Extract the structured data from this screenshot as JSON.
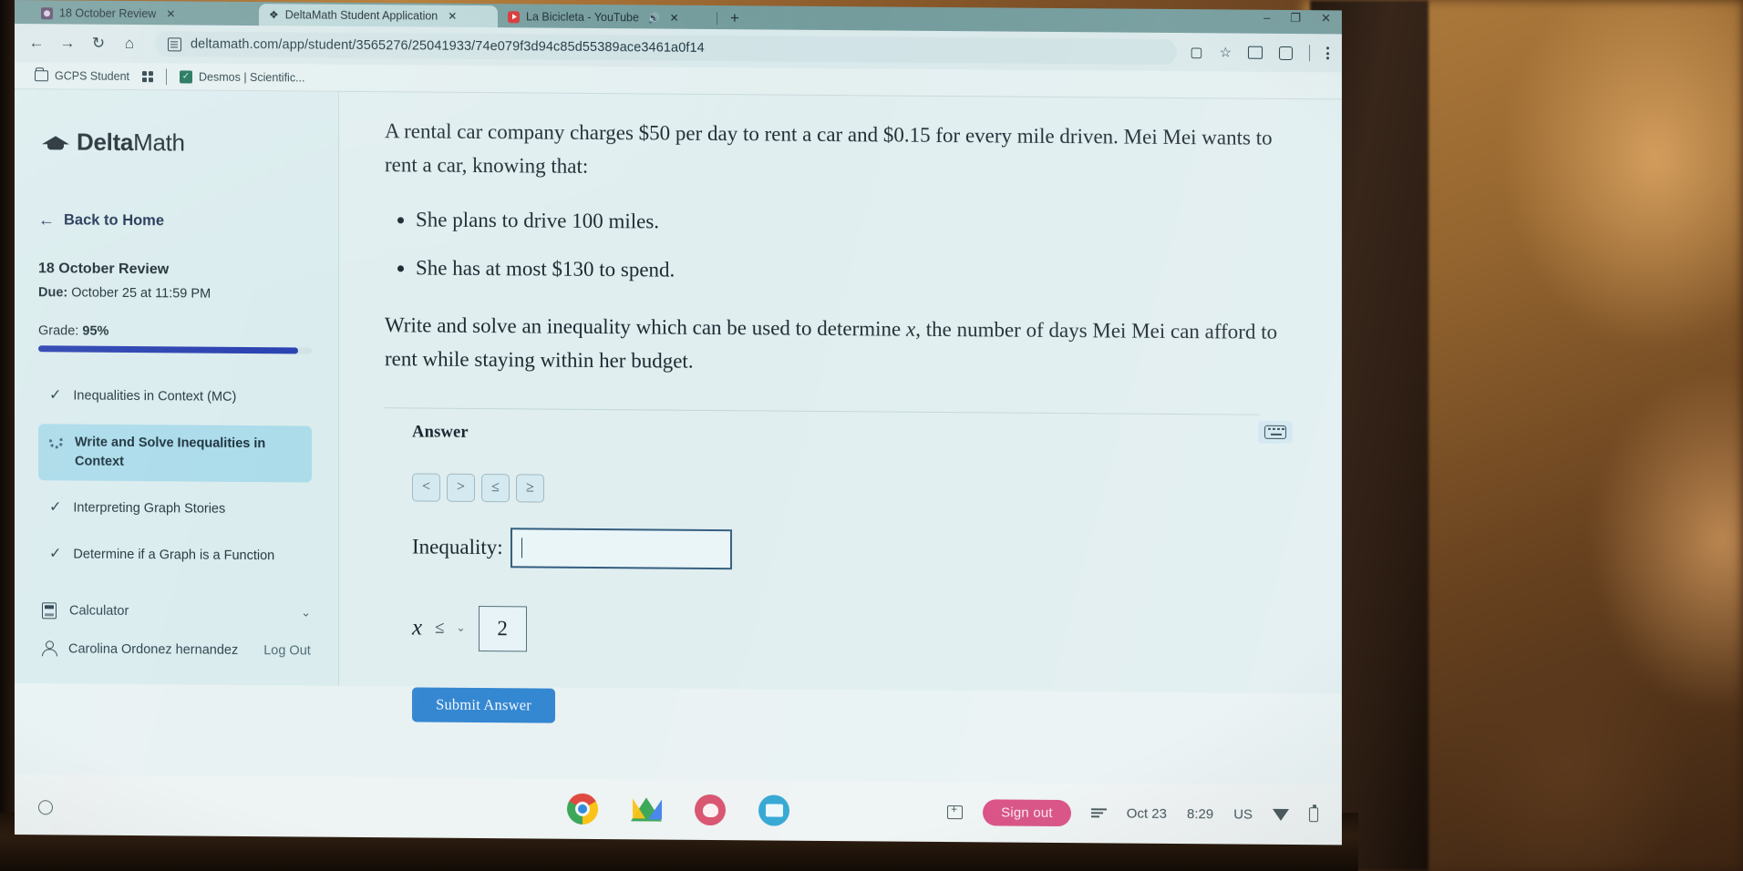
{
  "browser": {
    "tabs": [
      {
        "title": "18 October Review",
        "favicon": "person-purple-icon",
        "active": false,
        "close": "✕"
      },
      {
        "title": "DeltaMath Student Application",
        "favicon": "deltamath-icon",
        "active": true,
        "close": "✕"
      },
      {
        "title": "La Bicicleta - YouTube",
        "favicon": "youtube-icon",
        "active": false,
        "close": "✕",
        "audio": "🔊"
      }
    ],
    "new_tab": "+",
    "window_controls": {
      "minimize": "–",
      "maximize": "❐",
      "close": "✕"
    },
    "nav": {
      "back": "←",
      "forward": "→",
      "reload": "↻",
      "home": "⌂"
    },
    "url": "deltamath.com/app/student/3565276/25041933/74e079f3d94c85d55389ace3461a0f14",
    "bookmarks": [
      {
        "label": "GCPS Student",
        "icon": "folder-icon"
      },
      {
        "label": "",
        "icon": "apps-grid-icon"
      },
      {
        "label": "Desmos | Scientific...",
        "icon": "desmos-icon"
      }
    ]
  },
  "sidebar": {
    "brand_bold": "Delta",
    "brand_light": "Math",
    "back_home": "Back to Home",
    "assignment_title": "18 October Review",
    "due_label": "Due:",
    "due_value": "October 25 at 11:59 PM",
    "grade_label": "Grade:",
    "grade_value": "95%",
    "progress_percent": 95,
    "tasks": [
      {
        "label": "Inequalities in Context (MC)",
        "state": "complete",
        "icon": "check-icon"
      },
      {
        "label": "Write and Solve Inequalities in Context",
        "state": "current",
        "icon": "spinner-icon"
      },
      {
        "label": "Interpreting Graph Stories",
        "state": "complete",
        "icon": "check-icon"
      },
      {
        "label": "Determine if a Graph is a Function",
        "state": "complete",
        "icon": "check-icon"
      }
    ],
    "calculator_label": "Calculator",
    "calculator_chevron": "⌄",
    "user_name": "Carolina Ordonez hernandez",
    "logout_label": "Log Out"
  },
  "question": {
    "intro": "A rental car company charges $50 per day to rent a car and $0.15 for every mile driven. Mei Mei wants to rent a car, knowing that:",
    "bullets": [
      "She plans to drive 100 miles.",
      "She has at most $130 to spend."
    ],
    "prompt_before_var": "Write and solve an inequality which can be used to determine ",
    "prompt_var": "x",
    "prompt_after_var": ", the number of days Mei Mei can afford to rent while staying within her budget."
  },
  "answer": {
    "heading": "Answer",
    "keyboard_icon": "keyboard-icon",
    "symbol_buttons": [
      "<",
      ">",
      "≤",
      "≥"
    ],
    "inequality_label": "Inequality:",
    "inequality_value": "",
    "solution_variable": "x",
    "solution_operator": "≤",
    "operator_chevron": "⌄",
    "solution_value": "2",
    "submit_label": "Submit Answer"
  },
  "shelf": {
    "launcher": "launcher-circle-icon",
    "apps": [
      {
        "name": "chrome-icon"
      },
      {
        "name": "google-drive-icon"
      },
      {
        "name": "pink-app-icon"
      },
      {
        "name": "blue-app-icon"
      }
    ],
    "cast_icon": "cast-icon",
    "sign_out_label": "Sign out",
    "playlist_icon": "playlist-icon",
    "date": "Oct 23",
    "time": "8:29",
    "locale": "US",
    "wifi_icon": "wifi-icon",
    "battery_icon": "battery-icon"
  }
}
